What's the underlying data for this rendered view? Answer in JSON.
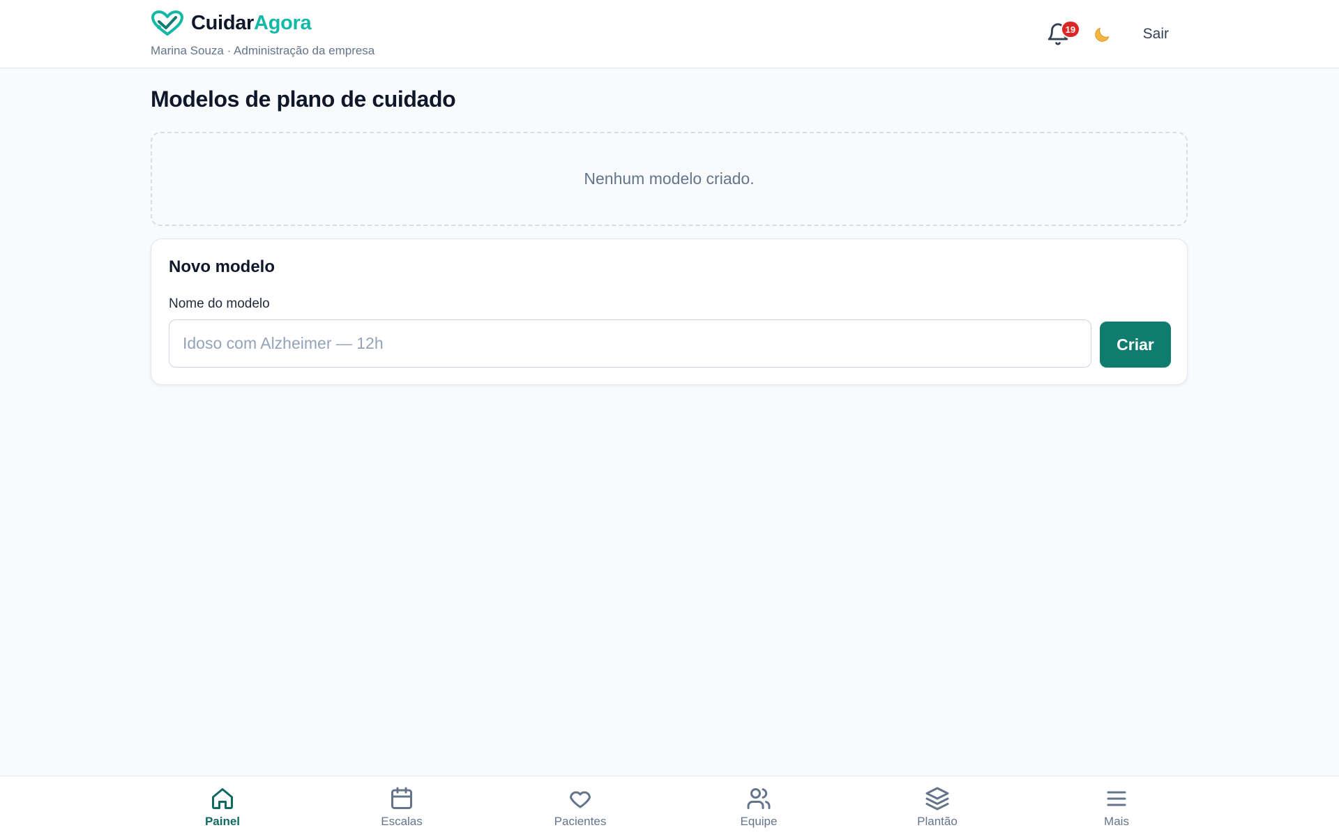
{
  "header": {
    "brand_part1": "Cuidar",
    "brand_part2": "Agora",
    "subtitle": "Marina Souza · Administração da empresa",
    "notification_count": "19",
    "theme_icon": "moon-icon",
    "logout_label": "Sair"
  },
  "main": {
    "title": "Modelos de plano de cuidado",
    "empty_message": "Nenhum modelo criado.",
    "new_model": {
      "title": "Novo modelo",
      "field_label": "Nome do modelo",
      "input_value": "",
      "input_placeholder": "Idoso com Alzheimer — 12h",
      "create_label": "Criar"
    }
  },
  "bottom_nav": {
    "items": [
      {
        "label": "Painel",
        "icon": "home-icon",
        "active": true
      },
      {
        "label": "Escalas",
        "icon": "calendar-icon",
        "active": false
      },
      {
        "label": "Pacientes",
        "icon": "heart-icon",
        "active": false
      },
      {
        "label": "Equipe",
        "icon": "users-icon",
        "active": false
      },
      {
        "label": "Plantão",
        "icon": "layers-icon",
        "active": false
      },
      {
        "label": "Mais",
        "icon": "menu-icon",
        "active": false
      }
    ]
  },
  "colors": {
    "brand_accent": "#14b8a6",
    "primary_button": "#0f7c6f",
    "active_nav": "#0f6b5f",
    "badge": "#dc2626"
  }
}
